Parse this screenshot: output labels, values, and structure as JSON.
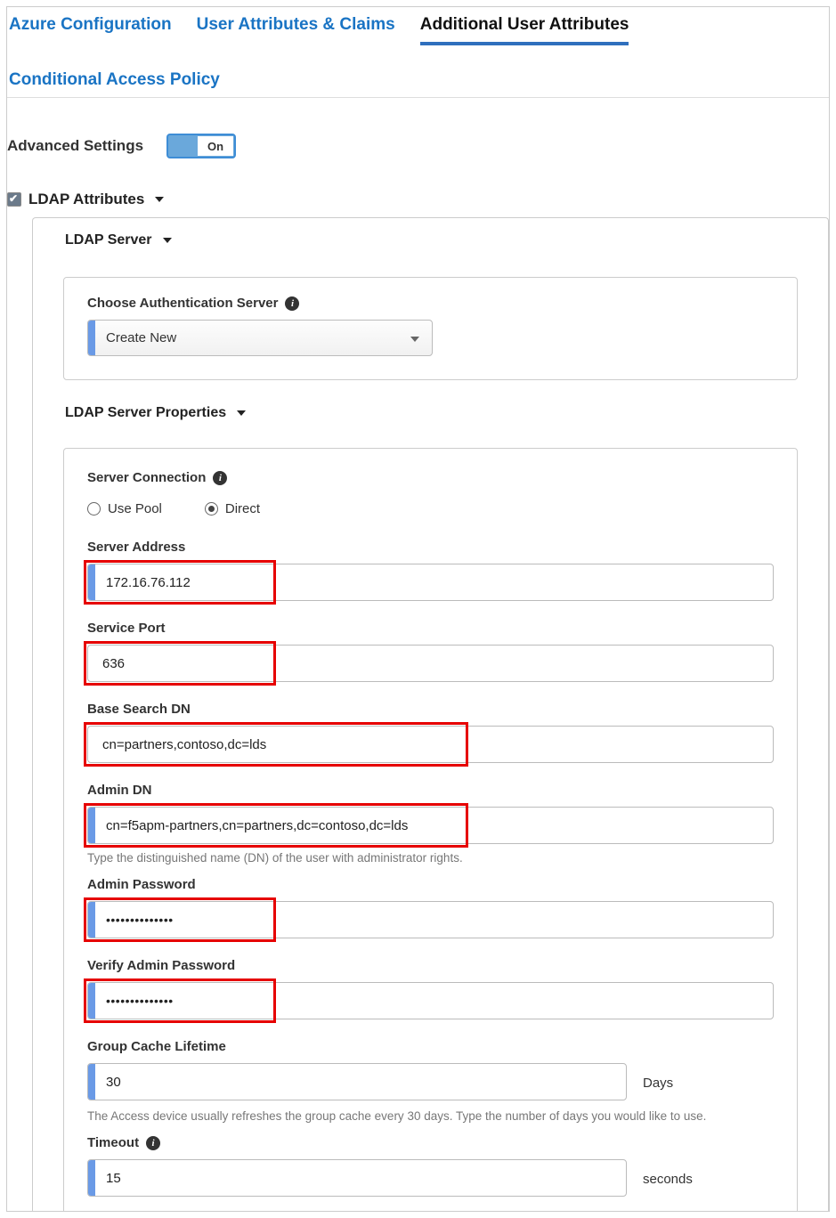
{
  "tabs": {
    "t1": "Azure Configuration",
    "t2": "User Attributes & Claims",
    "t3": "Additional User Attributes",
    "t4": "Conditional Access Policy"
  },
  "advanced": {
    "label": "Advanced Settings",
    "state": "On"
  },
  "sections": {
    "ldapAttr": "LDAP Attributes",
    "ldapServer": "LDAP Server",
    "ldapProps": "LDAP Server Properties"
  },
  "ldapServer": {
    "chooseLabel": "Choose Authentication Server",
    "selected": "Create New"
  },
  "props": {
    "serverConn": "Server Connection",
    "usePool": "Use Pool",
    "direct": "Direct",
    "connMode": "direct",
    "serverAddressLabel": "Server Address",
    "serverAddress": "172.16.76.112",
    "servicePortLabel": "Service Port",
    "servicePort": "636",
    "baseDnLabel": "Base Search DN",
    "baseDn": "cn=partners,contoso,dc=lds",
    "adminDnLabel": "Admin DN",
    "adminDn": "cn=f5apm-partners,cn=partners,dc=contoso,dc=lds",
    "adminDnHelp": "Type the distinguished name (DN) of the user with administrator rights.",
    "adminPwdLabel": "Admin Password",
    "adminPwd": "••••••••••••••",
    "verifyPwdLabel": "Verify Admin Password",
    "verifyPwd": "••••••••••••••",
    "cacheLabel": "Group Cache Lifetime",
    "cacheValue": "30",
    "cacheUnit": "Days",
    "cacheHelp": "The Access device usually refreshes the group cache every 30 days. Type the number of days you would like to use.",
    "timeoutLabel": "Timeout",
    "timeoutValue": "15",
    "timeoutUnit": "seconds"
  },
  "redbox": {
    "w_small": 212,
    "w_med": 428,
    "h": 46
  }
}
